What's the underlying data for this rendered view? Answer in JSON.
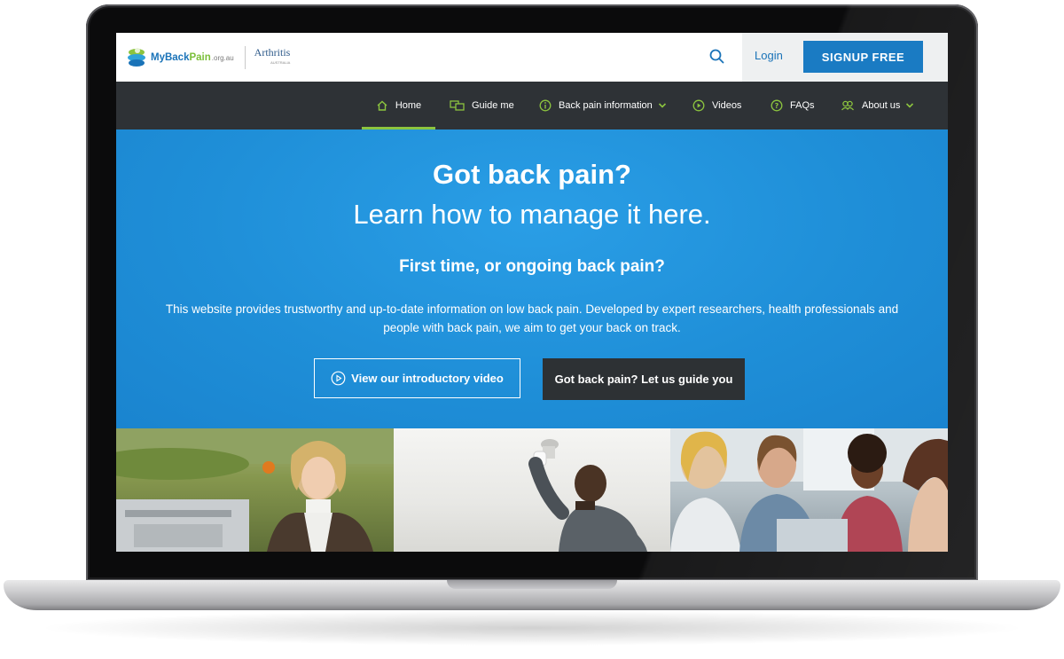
{
  "header": {
    "logo_name": "MyBack",
    "logo_name_accent": "Pain",
    "logo_domain": ".org.au",
    "partner_logo": "Arthritis",
    "partner_logo_small": "AUSTRALIA",
    "login_label": "Login",
    "signup_label": "SIGNUP FREE"
  },
  "nav": {
    "items": [
      {
        "label": "Home",
        "icon": "home-icon",
        "active": true
      },
      {
        "label": "Guide me",
        "icon": "guide-icon"
      },
      {
        "label": "Back pain information",
        "icon": "info-icon",
        "dropdown": true
      },
      {
        "label": "Videos",
        "icon": "play-icon"
      },
      {
        "label": "FAQs",
        "icon": "question-icon"
      },
      {
        "label": "About us",
        "icon": "people-icon",
        "dropdown": true
      }
    ]
  },
  "hero": {
    "title": "Got back pain?",
    "subtitle": "Learn how to manage it here.",
    "heading": "First time, or ongoing back pain?",
    "description": "This website provides trustworthy and up-to-date information on low back pain. Developed by expert researchers, health professionals and people with back pain, we aim to get your back on track.",
    "video_button": "View our introductory video",
    "guide_button": "Got back pain? Let us guide you"
  },
  "colors": {
    "brand_blue": "#1a7bc3",
    "accent_green": "#8cc43f",
    "nav_bg": "#2e3236",
    "hero_bg": "#1f8fd8"
  }
}
